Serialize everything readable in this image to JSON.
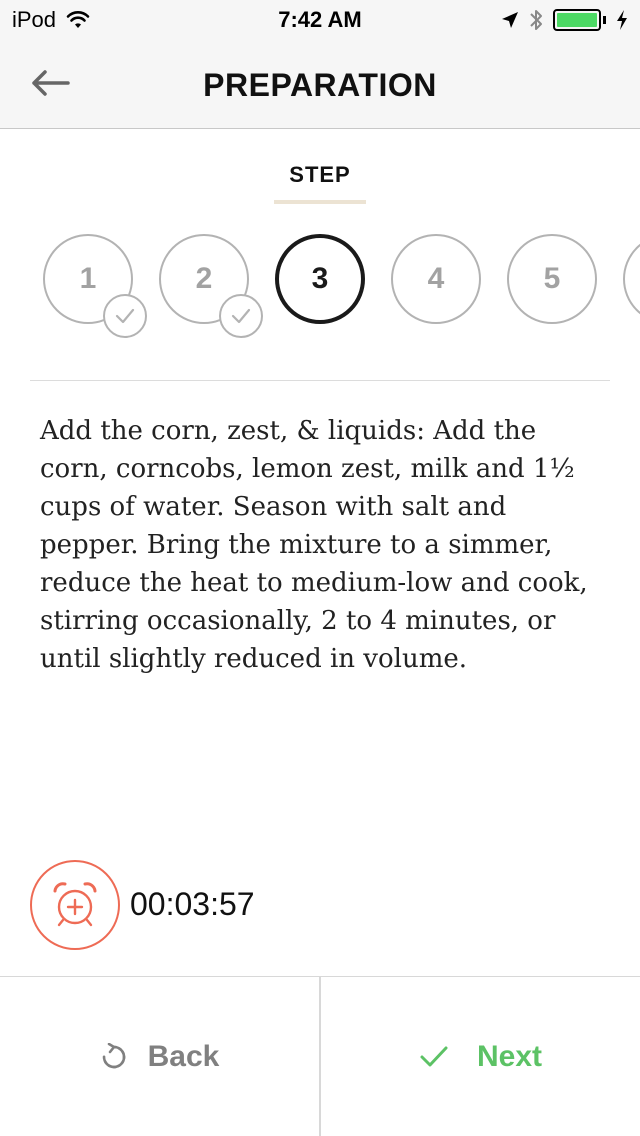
{
  "status_bar": {
    "carrier": "iPod",
    "time": "7:42 AM",
    "battery_color": "#4cd964"
  },
  "nav": {
    "title": "PREPARATION",
    "back_icon": "arrow-left-icon"
  },
  "step_header": {
    "label": "STEP"
  },
  "steps": [
    {
      "number": "1",
      "state": "completed"
    },
    {
      "number": "2",
      "state": "completed"
    },
    {
      "number": "3",
      "state": "active"
    },
    {
      "number": "4",
      "state": "pending"
    },
    {
      "number": "5",
      "state": "pending"
    },
    {
      "number": "",
      "state": "pending"
    }
  ],
  "instructions": {
    "text": "Add the corn, zest, & liquids: Add the corn, corncobs, lemon zest, milk and 1½ cups of water. Season with salt and pepper. Bring the mixture to a simmer, reduce the heat to medium-low and cook, stirring occasionally, 2 to 4 minutes, or until slightly reduced in volume."
  },
  "timer": {
    "value": "00:03:57",
    "icon": "alarm-clock-add-icon",
    "accent_color": "#ee6b55"
  },
  "actions": {
    "back_label": "Back",
    "back_icon": "restart-icon",
    "next_label": "Next",
    "next_icon": "checkmark-icon",
    "next_color": "#5cc265"
  }
}
